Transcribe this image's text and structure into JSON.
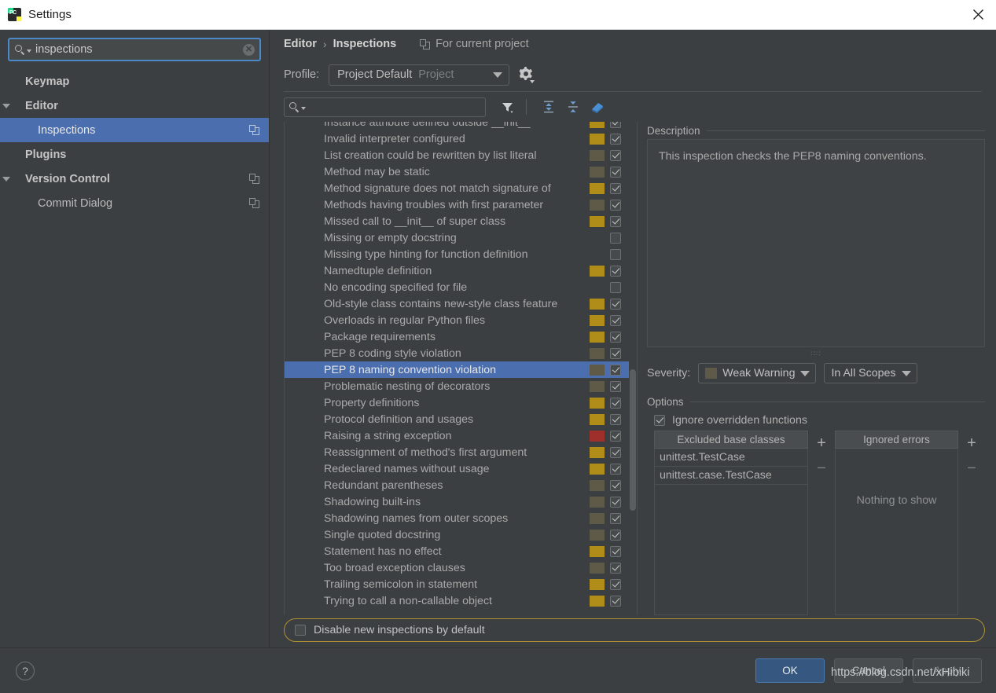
{
  "window": {
    "title": "Settings",
    "app_icon": "pycharm-icon",
    "close_icon": "close-icon"
  },
  "sidebar": {
    "search": {
      "value": "inspections",
      "placeholder": "",
      "icon": "search-icon",
      "clear_icon": "clear-icon"
    },
    "items": [
      {
        "label": "Keymap",
        "indent": 1,
        "bold": true,
        "expandable": false,
        "selected": false,
        "copy": false
      },
      {
        "label": "Editor",
        "indent": 0,
        "bold": true,
        "expandable": true,
        "selected": false,
        "copy": false
      },
      {
        "label": "Inspections",
        "indent": 2,
        "bold": false,
        "expandable": false,
        "selected": true,
        "copy": true
      },
      {
        "label": "Plugins",
        "indent": 1,
        "bold": true,
        "expandable": false,
        "selected": false,
        "copy": false
      },
      {
        "label": "Version Control",
        "indent": 0,
        "bold": true,
        "expandable": true,
        "selected": false,
        "copy": true
      },
      {
        "label": "Commit Dialog",
        "indent": 2,
        "bold": false,
        "expandable": false,
        "selected": false,
        "copy": true
      }
    ]
  },
  "breadcrumb": {
    "parent": "Editor",
    "separator": "›",
    "current": "Inspections",
    "for_current_project": "For current project"
  },
  "profile": {
    "label": "Profile:",
    "value": "Project Default",
    "scope": "Project",
    "gear_icon": "gear-icon"
  },
  "list_toolbar": {
    "search_placeholder": "",
    "filter_icon": "filter-icon",
    "expand_all_icon": "expand-all-icon",
    "collapse_all_icon": "collapse-all-icon",
    "reset_icon": "eraser-icon"
  },
  "inspections": [
    {
      "name": "Instance attribute defined outside __init__",
      "severity": "warning",
      "checked": true,
      "selected": false,
      "clipped_top": true
    },
    {
      "name": "Invalid interpreter configured",
      "severity": "warning",
      "checked": true,
      "selected": false
    },
    {
      "name": "List creation could be rewritten by list literal",
      "severity": "weak",
      "checked": true,
      "selected": false
    },
    {
      "name": "Method may be static",
      "severity": "weak",
      "checked": true,
      "selected": false
    },
    {
      "name": "Method signature does not match signature of",
      "severity": "warning",
      "checked": true,
      "selected": false
    },
    {
      "name": "Methods having troubles with first parameter",
      "severity": "weak",
      "checked": true,
      "selected": false
    },
    {
      "name": "Missed call to __init__ of super class",
      "severity": "warning",
      "checked": true,
      "selected": false
    },
    {
      "name": "Missing or empty docstring",
      "severity": "none",
      "checked": false,
      "selected": false
    },
    {
      "name": "Missing type hinting for function definition",
      "severity": "none",
      "checked": false,
      "selected": false
    },
    {
      "name": "Namedtuple definition",
      "severity": "warning",
      "checked": true,
      "selected": false
    },
    {
      "name": "No encoding specified for file",
      "severity": "none",
      "checked": false,
      "selected": false
    },
    {
      "name": "Old-style class contains new-style class feature",
      "severity": "warning",
      "checked": true,
      "selected": false
    },
    {
      "name": "Overloads in regular Python files",
      "severity": "warning",
      "checked": true,
      "selected": false
    },
    {
      "name": "Package requirements",
      "severity": "warning",
      "checked": true,
      "selected": false
    },
    {
      "name": "PEP 8 coding style violation",
      "severity": "weak",
      "checked": true,
      "selected": false
    },
    {
      "name": "PEP 8 naming convention violation",
      "severity": "weak",
      "checked": true,
      "selected": true
    },
    {
      "name": "Problematic nesting of decorators",
      "severity": "weak",
      "checked": true,
      "selected": false
    },
    {
      "name": "Property definitions",
      "severity": "warning",
      "checked": true,
      "selected": false
    },
    {
      "name": "Protocol definition and usages",
      "severity": "warning",
      "checked": true,
      "selected": false
    },
    {
      "name": "Raising a string exception",
      "severity": "error",
      "checked": true,
      "selected": false
    },
    {
      "name": "Reassignment of method's first argument",
      "severity": "warning",
      "checked": true,
      "selected": false
    },
    {
      "name": "Redeclared names without usage",
      "severity": "warning",
      "checked": true,
      "selected": false
    },
    {
      "name": "Redundant parentheses",
      "severity": "weak",
      "checked": true,
      "selected": false
    },
    {
      "name": "Shadowing built-ins",
      "severity": "weak",
      "checked": true,
      "selected": false
    },
    {
      "name": "Shadowing names from outer scopes",
      "severity": "weak",
      "checked": true,
      "selected": false
    },
    {
      "name": "Single quoted docstring",
      "severity": "weak",
      "checked": true,
      "selected": false
    },
    {
      "name": "Statement has no effect",
      "severity": "warning",
      "checked": true,
      "selected": false
    },
    {
      "name": "Too broad exception clauses",
      "severity": "weak",
      "checked": true,
      "selected": false
    },
    {
      "name": "Trailing semicolon in statement",
      "severity": "warning",
      "checked": true,
      "selected": false
    },
    {
      "name": "Trying to call a non-callable object",
      "severity": "warning",
      "checked": true,
      "selected": false,
      "clipped_bottom": true
    }
  ],
  "severity_colors": {
    "warning": "#b08d18",
    "weak": "#5f5a47",
    "error": "#9e2f2a",
    "none": "transparent"
  },
  "description": {
    "header": "Description",
    "text": "This inspection checks the PEP8 naming conventions."
  },
  "severity_control": {
    "label": "Severity:",
    "value": "Weak Warning",
    "swatch": "#5f5a47",
    "scope_value": "In All Scopes"
  },
  "options": {
    "header": "Options",
    "ignore_overridden": {
      "label": "Ignore overridden functions",
      "checked": true
    },
    "excluded_base_classes": {
      "header": "Excluded base classes",
      "items": [
        "unittest.TestCase",
        "unittest.case.TestCase"
      ],
      "add_label": "+",
      "remove_label": "−"
    },
    "ignored_errors": {
      "header": "Ignored errors",
      "items": [],
      "empty_text": "Nothing to show",
      "add_label": "+",
      "remove_label": "−"
    }
  },
  "disable_new": {
    "label": "Disable new inspections by default",
    "checked": false
  },
  "footer": {
    "help_label": "?",
    "ok": "OK",
    "cancel": "Cancel",
    "apply": "Apply"
  },
  "watermark": "https://blog.csdn.net/xHibiki"
}
